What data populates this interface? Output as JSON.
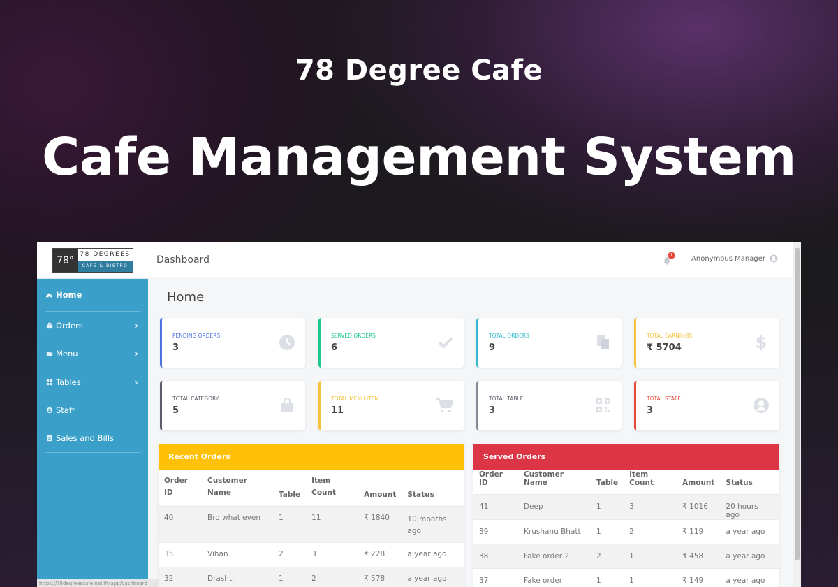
{
  "hero": {
    "subtitle": "78 Degree Cafe",
    "title": "Cafe Management System"
  },
  "logo": {
    "number": "78°",
    "name": "78 DEGREES",
    "tagline": "CAFE & BISTRO"
  },
  "sidebar": {
    "items": [
      {
        "label": "Home",
        "icon": "dashboard-icon",
        "active": true
      },
      {
        "label": "Orders",
        "icon": "bag-icon",
        "has_chevron": true
      },
      {
        "label": "Menu",
        "icon": "folder-icon",
        "has_chevron": true
      },
      {
        "label": "Tables",
        "icon": "grid-icon",
        "has_chevron": true
      },
      {
        "label": "Staff",
        "icon": "user-circle-icon"
      },
      {
        "label": "Sales and Bills",
        "icon": "receipt-icon"
      }
    ]
  },
  "topbar": {
    "breadcrumb": "Dashboard",
    "notification_count": "1",
    "user_name": "Anonymous Manager"
  },
  "page": {
    "title": "Home"
  },
  "stats": [
    {
      "label": "PENDING ORDERS",
      "value": "3",
      "color": "#4e73df",
      "icon": "clock-icon"
    },
    {
      "label": "SERVED ORDERS",
      "value": "6",
      "color": "#1cc88a",
      "icon": "check-icon"
    },
    {
      "label": "TOTAL ORDERS",
      "value": "9",
      "color": "#36b9cc",
      "icon": "copy-icon"
    },
    {
      "label": "TOTAL EARNINGS",
      "value": "₹ 5704",
      "color": "#f6c23e",
      "icon": "dollar-icon"
    },
    {
      "label": "TOTAL CATEGORY",
      "value": "5",
      "color": "#5a5c69",
      "icon": "shopping-bag-icon"
    },
    {
      "label": "TOTAL MENU ITEM",
      "value": "11",
      "color": "#f6c23e",
      "icon": "cart-icon"
    },
    {
      "label": "TOTAL TABLE",
      "value": "3",
      "color": "#858796",
      "icon": "qr-icon"
    },
    {
      "label": "TOTAL STAFF",
      "value": "3",
      "color": "#e74a3b",
      "icon": "user-icon"
    }
  ],
  "recent_orders": {
    "title": "Recent Orders",
    "header_color": "#ffc107",
    "columns": [
      [
        "Order",
        "ID"
      ],
      [
        "Customer",
        "Name"
      ],
      [
        "Table",
        ""
      ],
      [
        "Item",
        "Count"
      ],
      [
        "Amount",
        ""
      ],
      [
        "Status",
        ""
      ]
    ],
    "rows": [
      [
        "40",
        "Bro what even",
        "1",
        "11",
        "₹ 1840",
        "10 months",
        "ago"
      ],
      [
        "35",
        "Vihan",
        "2",
        "3",
        "₹ 228",
        "a year ago",
        ""
      ],
      [
        "32",
        "Drashti",
        "1",
        "2",
        "₹ 578",
        "a year ago",
        ""
      ]
    ]
  },
  "served_orders": {
    "title": "Served Orders",
    "header_color": "#dc3545",
    "columns": [
      "Order ID",
      "Customer Name",
      "Table",
      "Item Count",
      "Amount",
      "Status"
    ],
    "rows": [
      [
        "41",
        "Deep",
        "1",
        "3",
        "₹ 1016",
        "20 hours ago"
      ],
      [
        "39",
        "Krushanu Bhatt",
        "1",
        "2",
        "₹ 119",
        "a year ago"
      ],
      [
        "38",
        "Fake order 2",
        "2",
        "1",
        "₹ 458",
        "a year ago"
      ],
      [
        "37",
        "Fake order",
        "1",
        "1",
        "₹ 149",
        "a year ago"
      ]
    ]
  },
  "statusbar": {
    "url": "https://78degreescafe.netlify.app/dashboard"
  }
}
